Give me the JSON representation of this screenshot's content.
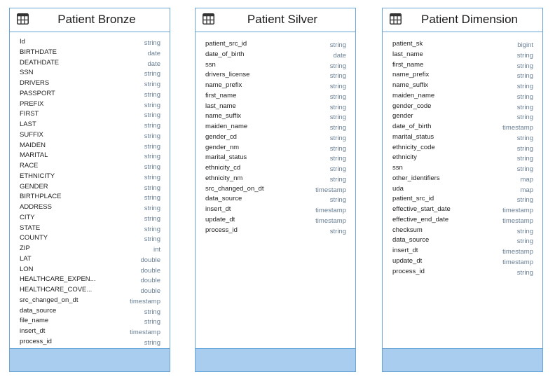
{
  "tables": [
    {
      "title": "Patient Bronze",
      "icon": "table-icon",
      "fields": [
        {
          "name": "Id",
          "type": "string"
        },
        {
          "name": "BIRTHDATE",
          "type": "date"
        },
        {
          "name": "DEATHDATE",
          "type": "date"
        },
        {
          "name": "SSN",
          "type": "string"
        },
        {
          "name": "DRIVERS",
          "type": "string"
        },
        {
          "name": "PASSPORT",
          "type": "string"
        },
        {
          "name": "PREFIX",
          "type": "string"
        },
        {
          "name": "FIRST",
          "type": "string"
        },
        {
          "name": "LAST",
          "type": "string"
        },
        {
          "name": "SUFFIX",
          "type": "string"
        },
        {
          "name": "MAIDEN",
          "type": "string"
        },
        {
          "name": "MARITAL",
          "type": "string"
        },
        {
          "name": "RACE",
          "type": "string"
        },
        {
          "name": "ETHNICITY",
          "type": "string"
        },
        {
          "name": "GENDER",
          "type": "string"
        },
        {
          "name": "BIRTHPLACE",
          "type": "string"
        },
        {
          "name": "ADDRESS",
          "type": "string"
        },
        {
          "name": "CITY",
          "type": "string"
        },
        {
          "name": "STATE",
          "type": "string"
        },
        {
          "name": "COUNTY",
          "type": "string"
        },
        {
          "name": "ZIP",
          "type": "int"
        },
        {
          "name": "LAT",
          "type": "double"
        },
        {
          "name": "LON",
          "type": "double"
        },
        {
          "name": "HEALTHCARE_EXPEN...",
          "type": "double"
        },
        {
          "name": "HEALTHCARE_COVE...",
          "type": "double"
        },
        {
          "name": "src_changed_on_dt",
          "type": "timestamp"
        },
        {
          "name": "data_source",
          "type": "string"
        },
        {
          "name": "file_name",
          "type": "string"
        },
        {
          "name": "insert_dt",
          "type": "timestamp"
        },
        {
          "name": "process_id",
          "type": "string"
        }
      ]
    },
    {
      "title": "Patient Silver",
      "icon": "table-icon",
      "fields": [
        {
          "name": "patient_src_id",
          "type": "string"
        },
        {
          "name": "date_of_birth",
          "type": "date"
        },
        {
          "name": "ssn",
          "type": "string"
        },
        {
          "name": "drivers_license",
          "type": "string"
        },
        {
          "name": "name_prefix",
          "type": "string"
        },
        {
          "name": "first_name",
          "type": "string"
        },
        {
          "name": "last_name",
          "type": "string"
        },
        {
          "name": "name_suffix",
          "type": "string"
        },
        {
          "name": "maiden_name",
          "type": "string"
        },
        {
          "name": "gender_cd",
          "type": "string"
        },
        {
          "name": "gender_nm",
          "type": "string"
        },
        {
          "name": "marital_status",
          "type": "string"
        },
        {
          "name": "ethnicity_cd",
          "type": "string"
        },
        {
          "name": "ethnicity_nm",
          "type": "string"
        },
        {
          "name": "src_changed_on_dt",
          "type": "timestamp"
        },
        {
          "name": "data_source",
          "type": "string"
        },
        {
          "name": "insert_dt",
          "type": "timestamp"
        },
        {
          "name": "update_dt",
          "type": "timestamp"
        },
        {
          "name": "process_id",
          "type": "string"
        }
      ]
    },
    {
      "title": "Patient Dimension",
      "icon": "table-icon",
      "fields": [
        {
          "name": "patient_sk",
          "type": "bigint"
        },
        {
          "name": "last_name",
          "type": "string"
        },
        {
          "name": "first_name",
          "type": "string"
        },
        {
          "name": "name_prefix",
          "type": "string"
        },
        {
          "name": "name_suffix",
          "type": "string"
        },
        {
          "name": "maiden_name",
          "type": "string"
        },
        {
          "name": "gender_code",
          "type": "string"
        },
        {
          "name": "gender",
          "type": "string"
        },
        {
          "name": "date_of_birth",
          "type": "timestamp"
        },
        {
          "name": "marital_status",
          "type": "string"
        },
        {
          "name": "ethnicity_code",
          "type": "string"
        },
        {
          "name": "ethnicity",
          "type": "string"
        },
        {
          "name": "ssn",
          "type": "string"
        },
        {
          "name": "other_identifiers",
          "type": "map"
        },
        {
          "name": "uda",
          "type": "map"
        },
        {
          "name": "patient_src_id",
          "type": "string"
        },
        {
          "name": "effective_start_date",
          "type": "timestamp"
        },
        {
          "name": "effective_end_date",
          "type": "timestamp"
        },
        {
          "name": "checksum",
          "type": "string"
        },
        {
          "name": "data_source",
          "type": "string"
        },
        {
          "name": "insert_dt",
          "type": "timestamp"
        },
        {
          "name": "update_dt",
          "type": "timestamp"
        },
        {
          "name": "process_id",
          "type": "string"
        }
      ]
    }
  ],
  "colors": {
    "border": "#6aa5d8",
    "footer": "#a9cdee",
    "type_text": "#6a7f94"
  }
}
